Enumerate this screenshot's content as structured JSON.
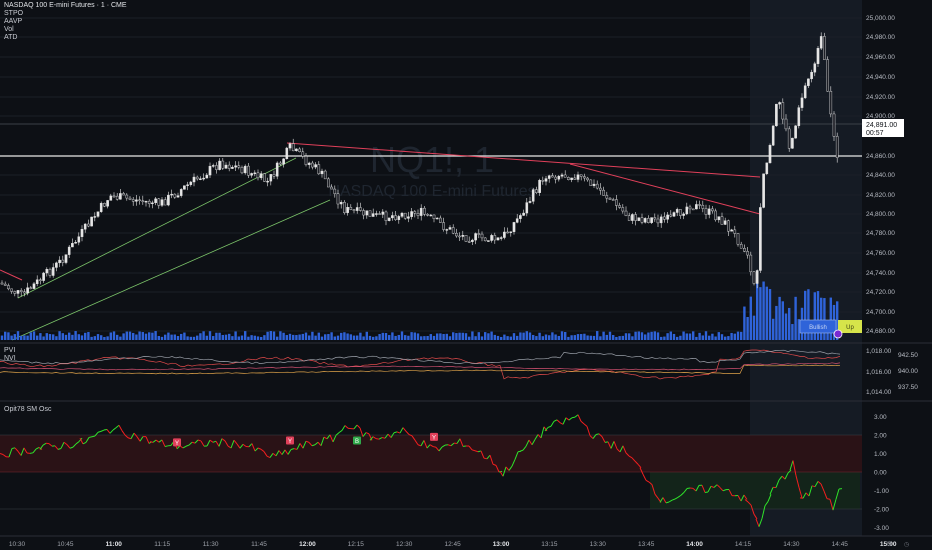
{
  "header": {
    "symbol_line": "NASDAQ 100 E-mini Futures · 1 · CME",
    "indicators": [
      "STPO",
      "AAVP",
      "Vol",
      "ATD"
    ]
  },
  "watermark": {
    "ticker": "NQ1!, 1",
    "name": "NASDAQ 100 E-mini Futures"
  },
  "price_axis": {
    "ticks": [
      "25,000.00",
      "24,980.00",
      "24,960.00",
      "24,940.00",
      "24,920.00",
      "24,900.00",
      "24,860.00",
      "24,840.00",
      "24,820.00",
      "24,800.00",
      "24,780.00",
      "24,760.00",
      "24,740.00",
      "24,720.00",
      "24,700.00",
      "24,680.00"
    ],
    "current_price": "24,891.00",
    "countdown": "00:57"
  },
  "volume_tags": {
    "left": "Bullish",
    "right": "Up"
  },
  "pvi_panel": {
    "labels": [
      "PVI",
      "NVI"
    ],
    "left_ticks": [
      "1,018.00",
      "1,016.00",
      "1,014.00"
    ],
    "right_ticks": [
      "942.50",
      "940.00",
      "937.50"
    ]
  },
  "osc_panel": {
    "title": "Opit78 SM Osc",
    "ticks": [
      "3.00",
      "2.00",
      "1.00",
      "0.00",
      "-1.00",
      "-2.00",
      "-3.00"
    ],
    "markers": [
      "Y",
      "Y",
      "B",
      "Y"
    ]
  },
  "time_axis": {
    "labels": [
      "10:30",
      "10:45",
      "11:00",
      "11:15",
      "11:30",
      "11:45",
      "12:00",
      "12:15",
      "12:30",
      "12:45",
      "13:00",
      "13:15",
      "13:30",
      "13:45",
      "14:00",
      "14:15",
      "14:30",
      "14:45",
      "15:00"
    ],
    "bold": [
      "11:00",
      "12:00",
      "13:00",
      "14:00",
      "15:00"
    ]
  },
  "colors": {
    "background": "#0d1015",
    "bull_candle": "#e6e6e6",
    "bear_candle": "#1d1f26",
    "volume": "#2f63d9",
    "trend_red": "#e0405a",
    "trend_green": "#7cc56a",
    "osc_up": "#2fe42a",
    "osc_down": "#f21f1f",
    "price_label": "#ffffff",
    "volume_tag": "#d6e44a"
  }
}
